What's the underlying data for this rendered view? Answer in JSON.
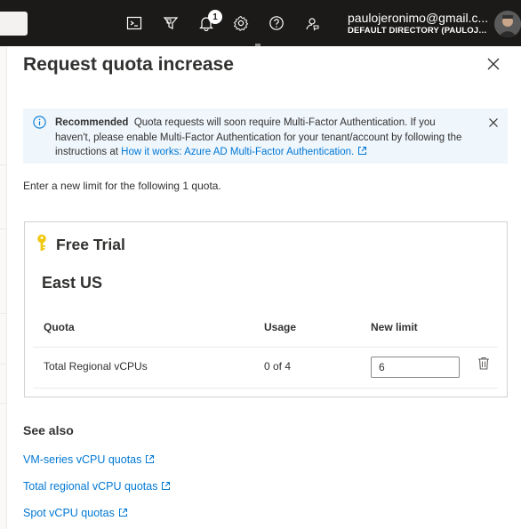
{
  "topbar": {
    "notification_count": "1",
    "icons": [
      "cloud-shell-icon",
      "directory-filter-icon",
      "notifications-icon",
      "settings-icon",
      "help-icon",
      "feedback-icon"
    ],
    "account_email": "paulojeronimo@gmail.c...",
    "account_directory": "DEFAULT DIRECTORY (PAULOJER..."
  },
  "panel": {
    "title": "Request quota increase",
    "info": {
      "heading": "Recommended",
      "text": "Quota requests will soon require Multi-Factor Authentication. If you haven't, please enable Multi-Factor Authentication for your tenant/account by following the instructions at",
      "link": "How it works: Azure AD Multi-Factor Authentication."
    },
    "intro": "Enter a new limit for the following 1 quota.",
    "card": {
      "subscription": "Free Trial",
      "region": "East US",
      "columns": [
        "Quota",
        "Usage",
        "New limit"
      ],
      "rows": [
        {
          "quota": "Total Regional vCPUs",
          "usage": "0 of 4",
          "new_limit": "6"
        }
      ]
    },
    "see_also": {
      "heading": "See also",
      "links": [
        "VM-series vCPU quotas",
        "Total regional vCPU quotas",
        "Spot vCPU quotas"
      ]
    }
  },
  "colors": {
    "topbar_bg": "#1b1a19",
    "accent": "#0078d4",
    "info_bg": "#eff6fc",
    "key_icon": "#f2c811"
  }
}
